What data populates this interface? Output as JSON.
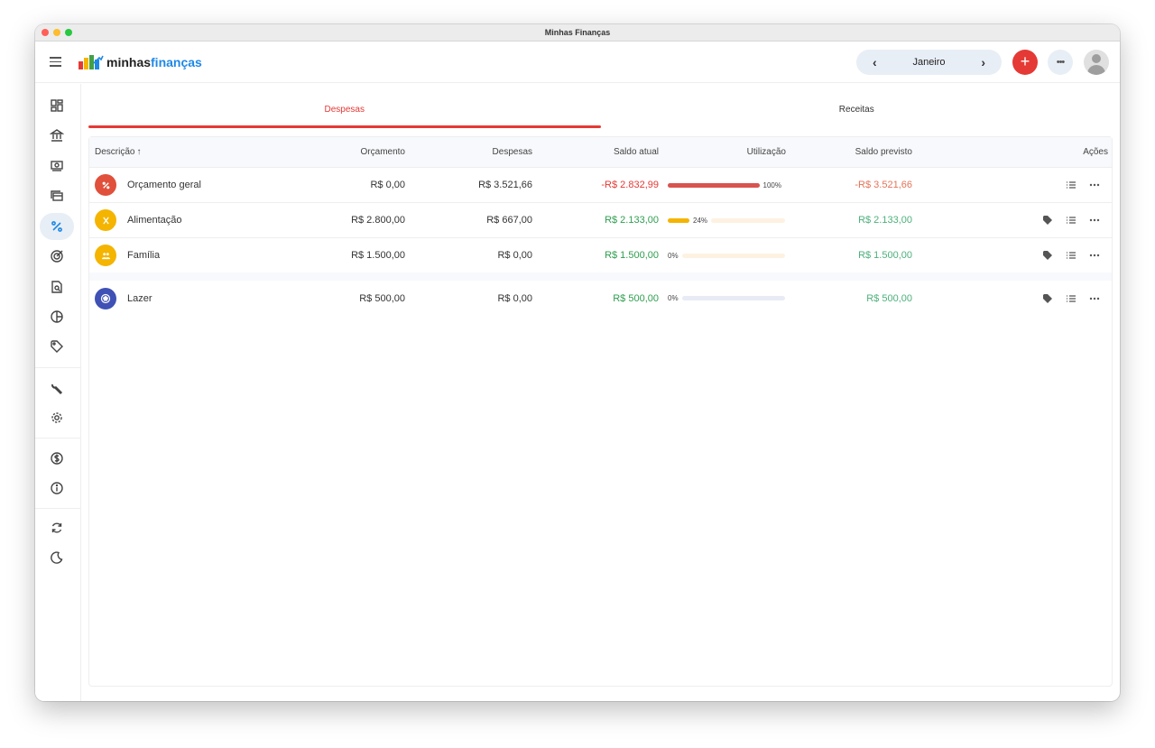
{
  "window": {
    "title": "Minhas Finanças"
  },
  "appbar": {
    "logo_main": "minhas",
    "logo_accent": "finanças",
    "month": "Janeiro",
    "prev_icon": "chevron-left-icon",
    "next_icon": "chevron-right-icon",
    "add_icon": "plus-icon",
    "more_icon": "more-horizontal-icon"
  },
  "sidebar": {
    "items": [
      {
        "icon": "dashboard-icon"
      },
      {
        "icon": "bank-icon"
      },
      {
        "icon": "cash-icon"
      },
      {
        "icon": "cards-icon"
      },
      {
        "icon": "percent-icon",
        "active": true
      },
      {
        "icon": "target-icon"
      },
      {
        "icon": "report-search-icon"
      },
      {
        "icon": "pie-chart-icon"
      },
      {
        "icon": "tag-icon"
      },
      {
        "icon": "wrench-icon"
      },
      {
        "icon": "settings-icon"
      },
      {
        "icon": "dollar-icon"
      },
      {
        "icon": "info-icon"
      },
      {
        "icon": "sync-icon"
      },
      {
        "icon": "dark-mode-icon"
      }
    ]
  },
  "tabs": [
    {
      "label": "Despesas",
      "active": true
    },
    {
      "label": "Receitas",
      "active": false
    }
  ],
  "table": {
    "headers": {
      "descricao": "Descrição",
      "sort_icon": "arrow-up-icon",
      "orcamento": "Orçamento",
      "despesas": "Despesas",
      "saldo_atual": "Saldo atual",
      "utilizacao": "Utilização",
      "saldo_previsto": "Saldo previsto",
      "acoes": "Ações"
    },
    "rows": [
      {
        "name": "Orçamento geral",
        "icon": "percent-icon",
        "icon_color": "#e0503b",
        "orcamento": "R$ 0,00",
        "despesas": "R$ 3.521,66",
        "saldo_atual": "-R$ 2.832,99",
        "saldo_status": "negative",
        "utilizacao": "100%",
        "util_value": 1.0,
        "bar_color": "#d9534f",
        "track_color": "#f3d2cc",
        "saldo_previsto": "-R$ 3.521,66",
        "previsto_status": "negative"
      },
      {
        "name": "Alimentação",
        "icon": "restaurant-icon",
        "icon_color": "#f4b400",
        "orcamento": "R$ 2.800,00",
        "despesas": "R$ 667,00",
        "saldo_atual": "R$ 2.133,00",
        "saldo_status": "positive",
        "utilizacao": "24%",
        "util_value": 0.24,
        "bar_color": "#f4b400",
        "track_color": "#fdf2e2",
        "saldo_previsto": "R$ 2.133,00",
        "previsto_status": "positive"
      },
      {
        "name": "Família",
        "icon": "family-icon",
        "icon_color": "#f4b400",
        "orcamento": "R$ 1.500,00",
        "despesas": "R$ 0,00",
        "saldo_atual": "R$ 1.500,00",
        "saldo_status": "positive",
        "utilizacao": "0%",
        "util_value": 0.0,
        "bar_color": "#f4b400",
        "track_color": "#fdf2e2",
        "saldo_previsto": "R$ 1.500,00",
        "previsto_status": "positive"
      },
      {
        "name": "Lazer",
        "icon": "soccer-icon",
        "icon_color": "#3f51b5",
        "orcamento": "R$ 500,00",
        "despesas": "R$ 0,00",
        "saldo_atual": "R$ 500,00",
        "saldo_status": "positive",
        "utilizacao": "0%",
        "util_value": 0.0,
        "bar_color": "#3f51b5",
        "track_color": "#e8ebf5",
        "saldo_previsto": "R$ 500,00",
        "previsto_status": "positive"
      }
    ]
  },
  "colors": {
    "accent": "#e53935",
    "brand_blue": "#1e88e5",
    "positive": "#2e9e4f",
    "negative": "#e53935"
  }
}
